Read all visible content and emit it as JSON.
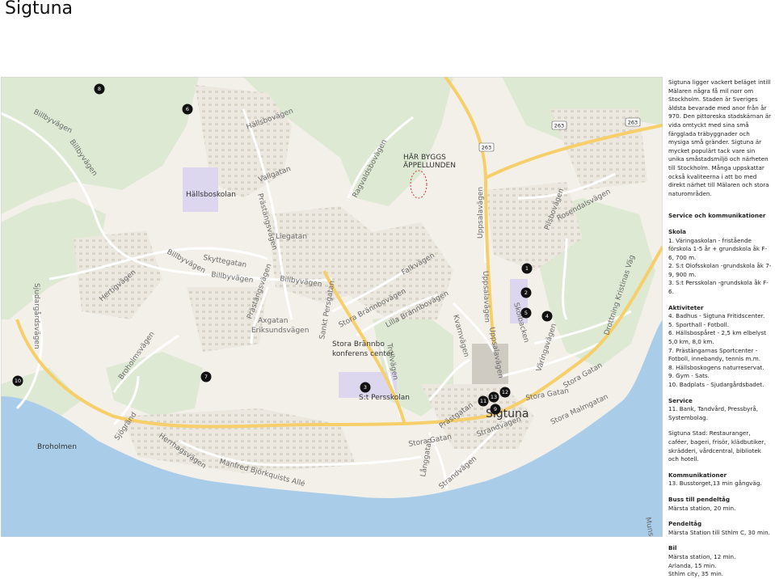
{
  "title": "Sigtuna",
  "map": {
    "road_number": "263",
    "callout": [
      "HÄR BYGGS",
      "ÄPPELLUNDEN"
    ],
    "town_label": "Sigtuna",
    "places": {
      "hallsboskolan": "Hällsboskolan",
      "persskolan": "S:t Persskolan",
      "brannbo": [
        "Stora Brännbo",
        "konferens center"
      ],
      "broholmen": "Broholmen"
    },
    "streets": {
      "billbyvagen": "Billbyvägen",
      "hallsbovagen": "Hällsbovägen",
      "vallgatan": "Vallgatan",
      "prastangsvagen": "Prästängsvägen",
      "liegatan": "Liegatan",
      "ragvaldsbovagen": "Ragvaldsbovägen",
      "uppsalavagen": "Uppsalavägen",
      "pilsbovagen": "Pilsbovägen",
      "rosendalsvagen": "Rosendalsvägen",
      "skyttegatan": "Skyttegatan",
      "hertigvagen": "Hertigvägen",
      "sjudargardsvagen": "Sjudargårdsvägen",
      "axgatan": "Axgatan",
      "eriksundsvagen": "Eriksundsvägen",
      "sanktpersgatan": "Sankt Persgatan",
      "storabrannbovagen": "Stora Brännbovägen",
      "falkvagen": "Falkvägen",
      "lillabrannbovagen": "Lilla Brännbovägen",
      "kvarnvagen": "Kvarnvägen",
      "skolbacken": "Skolbacken",
      "drottningkristinasvag": "Drottning Kristinas Väg",
      "varingavagen": "Väringavägen",
      "storagatan": "Stora Gatan",
      "storamalmgatan": "Stora Malmgatan",
      "broholmsvagen": "Broholmsvägen",
      "sjogrand": "Sjögränd",
      "herrhagsvagen": "Herrhagsvägen",
      "manfredbjorkquistsalle": "Manfred Björkquists Allé",
      "prastgatan": "Prästgatan",
      "trollvagen": "Trollvägen",
      "langgatan": "Långgatan",
      "strandvagen": "Strandvägen",
      "munsovagen": "Munsö"
    },
    "markers": [
      "1",
      "2",
      "3",
      "4",
      "5",
      "6",
      "7",
      "8",
      "9",
      "10",
      "11",
      "12",
      "13"
    ]
  },
  "sidebar": {
    "intro": "Sigtuna ligger vackert beläget intill Mälaren några få mil norr om Stockholm. Staden är Sveriges äldsta bevarade med anor från år 970. Den pittoreska stadskärnan är vida omtyckt med sina små färgglada träbyggnader och mysiga små gränder. Sigtuna är mycket populärt tack vare sin unika småstadsmiljö och närheten till Stockholm. Många uppskattar också kvaliteerna i att bo med direkt närhet till Mälaren och stora naturområden.",
    "service_heading": "Service och kommunikationer",
    "skola_heading": "Skola",
    "skola": [
      "1. Väringaskolan - fristående förskola 1-5 år + grundskola åk F-6, 700 m.",
      "2. S:t Olofsskolan -grundskola åk 7-9, 900 m.",
      "3. S:t Persskolan -grundskola åk F-6."
    ],
    "aktiviteter_heading": "Aktiviteter",
    "aktiviteter": [
      "4. Badhus - Sigtuna Fritidscenter.",
      "5. Sporthall - Fotboll.",
      "6. Hällsbospåret - 2,5 km elbelyst 5,0 km, 8,0 km.",
      "7. Prästängarnas Sportcenter - Fotboll, innebandy, tennis m.m.",
      "8. Hällsboskogens naturreservat.",
      "9. Gym - Sats.",
      "10. Badplats - Sjudargårdsbadet."
    ],
    "service_sub_heading": "Service",
    "service": [
      "11. Bank, Tandvård, Pressbyrå, Systembolag."
    ],
    "stad": "Sigtuna Stad: Restauranger, caféer, bageri, frisör, klädbutiker, skrädderi, vårdcentral, bibliotek och hotell.",
    "komm_heading": "Kommunikationer",
    "komm": [
      "13. Busstorget,13 min gångväg."
    ],
    "buss_heading": "Buss till pendeltåg",
    "buss": [
      "Märsta station, 20 min."
    ],
    "pendel_heading": "Pendeltåg",
    "pendel": [
      "Märsta Station till Sthlm C, 30 min."
    ],
    "bil_heading": "Bil",
    "bil": [
      "Märsta station, 12 min.",
      "Arlanda, 15 min.",
      "Sthlm city, 35 min."
    ]
  },
  "colors": {
    "land": "#f3f0e9",
    "forest": "#dde9d3",
    "water": "#a9cde9",
    "road_major": "#f6cf6a",
    "marker": "#111111",
    "school": "#ddd6ef"
  }
}
